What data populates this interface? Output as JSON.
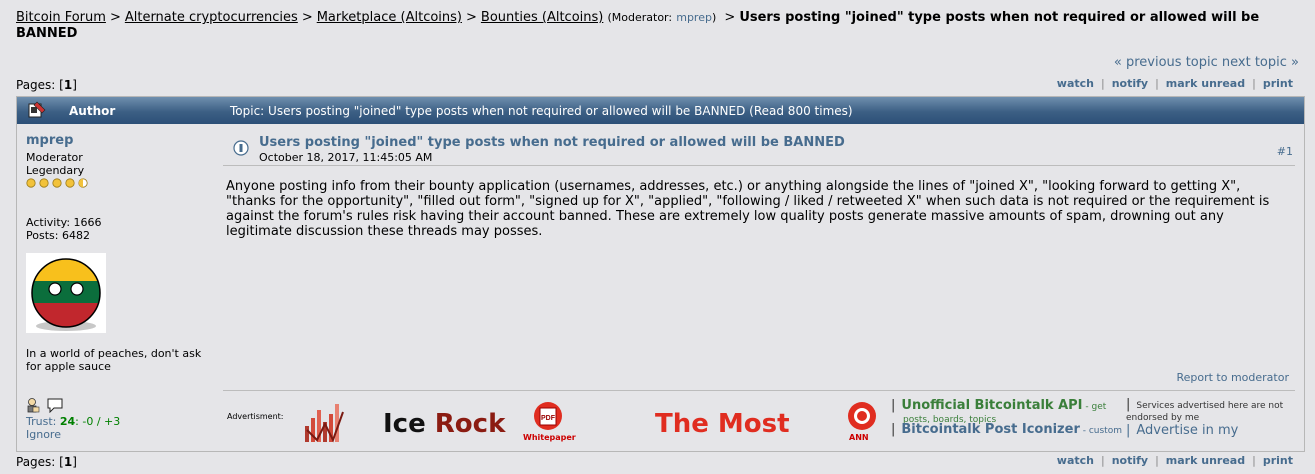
{
  "breadcrumb": {
    "items": [
      "Bitcoin Forum",
      "Alternate cryptocurrencies",
      "Marketplace (Altcoins)",
      "Bounties (Altcoins)"
    ],
    "separator": ">",
    "moderator_label": "(Moderator:",
    "moderator_name": "mprep",
    "moderator_close": ")",
    "title": "Users posting \"joined\" type posts when not required or allowed will be BANNED"
  },
  "topic_nav": {
    "previous": "« previous topic",
    "next": "next topic »"
  },
  "pages": {
    "label": "Pages: [",
    "current": "1",
    "close": "]"
  },
  "actions": [
    "watch",
    "notify",
    "mark unread",
    "print"
  ],
  "header": {
    "author_label": "Author",
    "topic_label": "Topic: Users posting \"joined\" type posts when not required or allowed will be BANNED  (Read 800 times)"
  },
  "poster": {
    "name": "mprep",
    "group": "Moderator",
    "rank": "Legendary",
    "activity": "Activity: 1666",
    "posts": "Posts: 6482",
    "personal_text": "In a world of peaches, don't ask for apple sauce",
    "trust_label": "Trust:",
    "trust_score": "24",
    "trust_neg": ": -0 / ",
    "trust_pos": "+3",
    "ignore": "Ignore"
  },
  "post": {
    "subject": "Users posting \"joined\" type posts when not required or allowed will be BANNED",
    "date": "October 18, 2017, 11:45:05 AM",
    "number": "#1",
    "body": "Anyone posting info from their bounty application (usernames, addresses, etc.) or anything alongside the lines of \"joined X\", \"looking forward to getting X\", \"thanks for the opportunity\", \"filled out form\", \"signed up for X\", \"applied\", \"following / liked / retweeted X\" when such data is not required or the requirement is against the forum's rules risk having their account banned. These are extremely low quality posts generate massive amounts of spam, drowning out any legitimate discussion these threads may posses.",
    "report": "Report to moderator"
  },
  "ad": {
    "label": "Advertisment:",
    "ice": "Ice",
    "rock": " Rock",
    "whitepaper": "Whitepaper",
    "themost": "The Most",
    "ann": "ANN",
    "api_title": "Unofficial Bitcointalk API",
    "api_desc": " - get",
    "api_desc2": "posts, boards, topics",
    "iconizer_title": "Bitcointalk Post Iconizer",
    "iconizer_desc": " - custom",
    "disclaimer": "Services advertised here are not endorsed by me",
    "advertise": "Advertise in my"
  },
  "colors": {
    "link": "#476c8e",
    "header_bg": "#3c5f84",
    "page_bg": "#e5e5e8",
    "trust_green": "#008000"
  }
}
